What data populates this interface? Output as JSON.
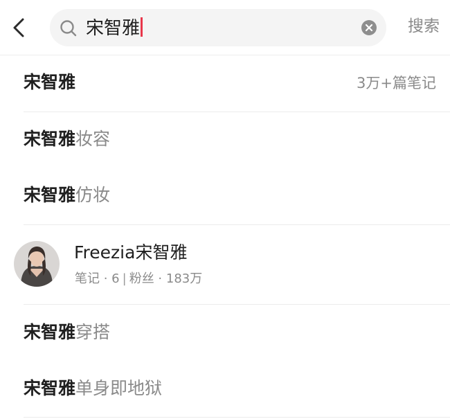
{
  "search": {
    "query": "宋智雅",
    "submit_label": "搜索"
  },
  "suggestions": [
    {
      "keyword": "宋智雅",
      "suffix": "",
      "count": "3万+篇笔记"
    },
    {
      "keyword": "宋智雅",
      "suffix": "妆容"
    },
    {
      "keyword": "宋智雅",
      "suffix": "仿妆"
    }
  ],
  "user": {
    "name": "Freezia宋智雅",
    "notes_label": "笔记",
    "notes_count": "6",
    "fans_label": "粉丝",
    "fans_count": "183万"
  },
  "more_suggestions": [
    {
      "keyword": "宋智雅",
      "suffix": "穿搭"
    },
    {
      "keyword": "宋智雅",
      "suffix": "单身即地狱"
    }
  ],
  "colors": {
    "caret": "#e8364a",
    "muted_text": "#8a8a8a",
    "search_bg": "#f4f4f4"
  }
}
